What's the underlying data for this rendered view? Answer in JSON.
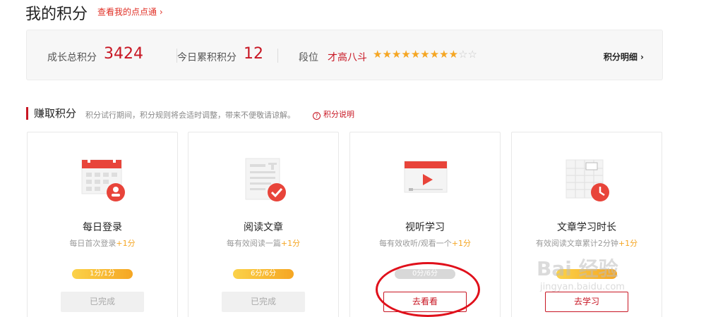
{
  "header": {
    "title": "我的积分",
    "dots_link": "查看我的点点通"
  },
  "summary": {
    "growth_label": "成长总积分",
    "growth_value": "3424",
    "today_label": "今日累积积分",
    "today_value": "12",
    "rank_label": "段位",
    "rank_value": "才高八斗",
    "stars_filled": 9,
    "stars_total": 11,
    "detail_link": "积分明细"
  },
  "earn": {
    "title": "赚取积分",
    "note": "积分试行期间，积分规则将会适时调整，带来不便敬请谅解。",
    "help_link": "积分说明"
  },
  "cards": [
    {
      "title": "每日登录",
      "desc": "每日首次登录",
      "plus": "+1分",
      "progress": "1分/1分",
      "button": "已完成",
      "icon": "calendar-user-icon"
    },
    {
      "title": "阅读文章",
      "desc": "每有效阅读一篇",
      "plus": "+1分",
      "progress": "6分/6分",
      "button": "已完成",
      "icon": "article-check-icon"
    },
    {
      "title": "视听学习",
      "desc": "每有效收听/观看一个",
      "plus": "+1分",
      "progress": "0分/6分",
      "button": "去看看",
      "icon": "video-play-icon"
    },
    {
      "title": "文章学习时长",
      "desc": "有效阅读文章累计2分钟",
      "plus": "+1分",
      "progress": "",
      "button": "去学习",
      "icon": "table-clock-icon"
    }
  ],
  "watermark": {
    "brand": "Bai 经验",
    "url": "jingyan.baidu.com"
  },
  "colors": {
    "accent": "#c81623",
    "star": "#f5a623",
    "progress": "#f5a623"
  }
}
